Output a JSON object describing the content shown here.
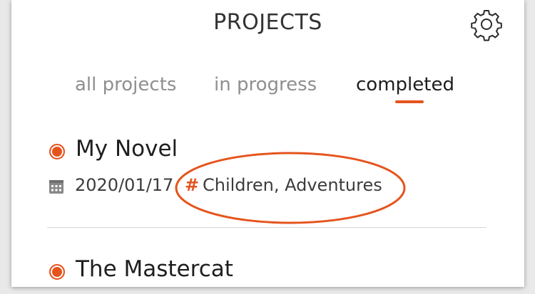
{
  "header": {
    "title": "PROJECTS",
    "settings_icon": "gear-icon"
  },
  "tabs": [
    {
      "label": "all projects",
      "active": false
    },
    {
      "label": "in progress",
      "active": false
    },
    {
      "label": "completed",
      "active": true
    }
  ],
  "projects": [
    {
      "name": "My Novel",
      "date": "2020/01/17",
      "tag_symbol": "#",
      "tags": "Children, Adventures"
    },
    {
      "name": "The Mastercat"
    }
  ],
  "colors": {
    "accent": "#e5541d",
    "text": "#1e1e1e",
    "muted": "#8f8f8f",
    "divider": "#d4d4d4"
  }
}
